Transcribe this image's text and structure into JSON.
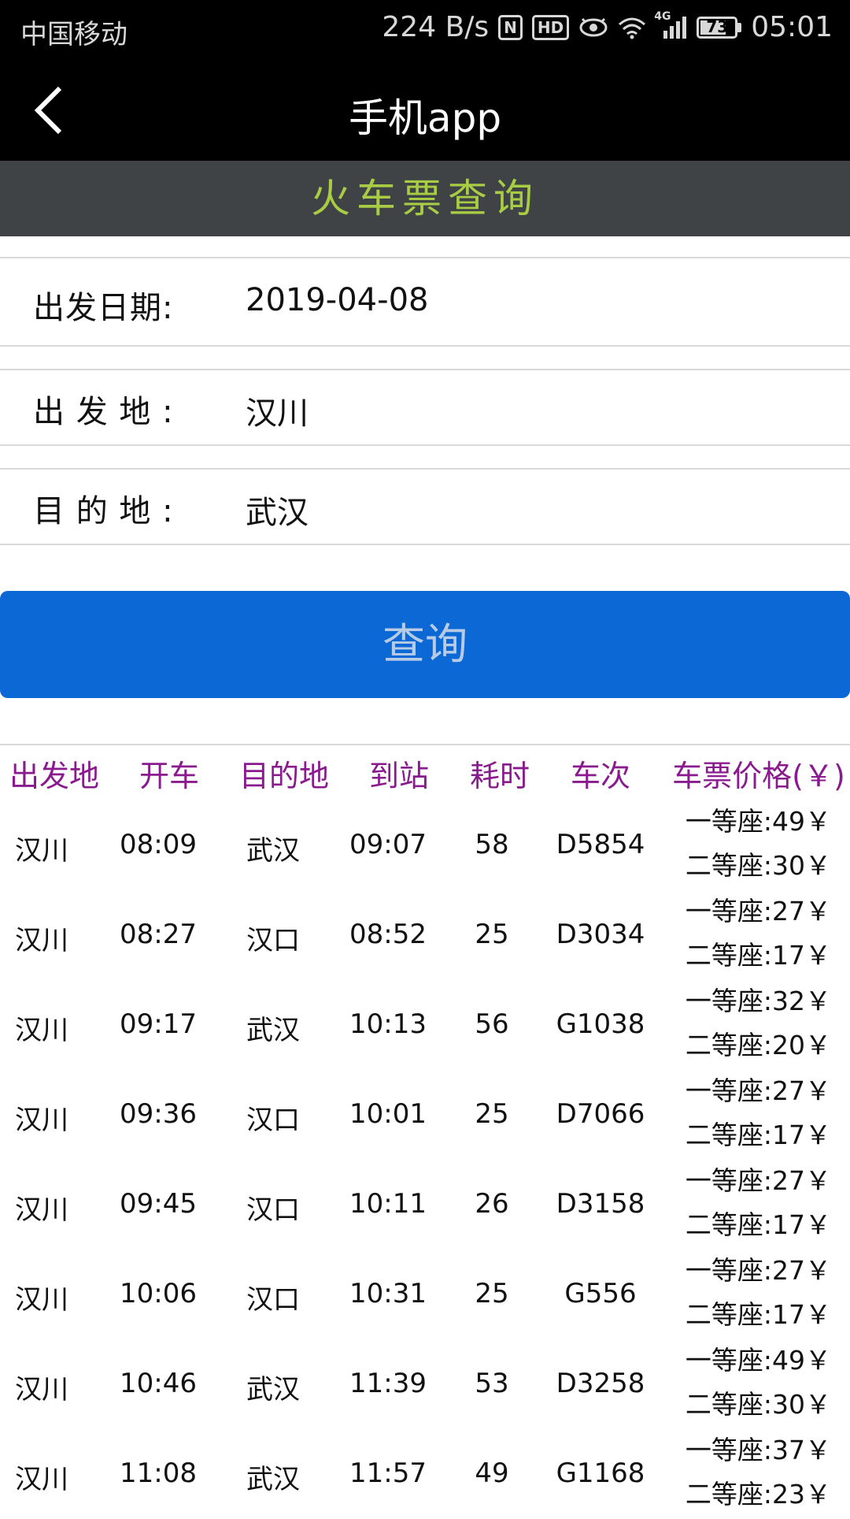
{
  "status_bar": {
    "carrier": "中国移动",
    "net_speed": "224 B/s",
    "nfc": "N",
    "hd": "HD",
    "network": "4G",
    "battery": "73",
    "time": "05:01"
  },
  "app_bar": {
    "title": "手机app"
  },
  "subheader": {
    "title": "火车票查询"
  },
  "form": {
    "date_label": "出发日期:",
    "date_value": "2019-04-08",
    "from_label": "出 发 地 :",
    "from_value": "汉川",
    "to_label": "目 的 地 :",
    "to_value": "武汉"
  },
  "query_button": {
    "label": "查询"
  },
  "table": {
    "headers": [
      "出发地",
      "开车",
      "目的地",
      "到站",
      "耗时",
      "车次",
      "车票价格(￥)"
    ],
    "rows": [
      {
        "from": "汉川",
        "depart": "08:09",
        "to": "武汉",
        "arrive": "09:07",
        "duration": "58",
        "train": "D5854",
        "first": "一等座:49￥",
        "second": "二等座:30￥"
      },
      {
        "from": "汉川",
        "depart": "08:27",
        "to": "汉口",
        "arrive": "08:52",
        "duration": "25",
        "train": "D3034",
        "first": "一等座:27￥",
        "second": "二等座:17￥"
      },
      {
        "from": "汉川",
        "depart": "09:17",
        "to": "武汉",
        "arrive": "10:13",
        "duration": "56",
        "train": "G1038",
        "first": "一等座:32￥",
        "second": "二等座:20￥"
      },
      {
        "from": "汉川",
        "depart": "09:36",
        "to": "汉口",
        "arrive": "10:01",
        "duration": "25",
        "train": "D7066",
        "first": "一等座:27￥",
        "second": "二等座:17￥"
      },
      {
        "from": "汉川",
        "depart": "09:45",
        "to": "汉口",
        "arrive": "10:11",
        "duration": "26",
        "train": "D3158",
        "first": "一等座:27￥",
        "second": "二等座:17￥"
      },
      {
        "from": "汉川",
        "depart": "10:06",
        "to": "汉口",
        "arrive": "10:31",
        "duration": "25",
        "train": "G556",
        "first": "一等座:27￥",
        "second": "二等座:17￥"
      },
      {
        "from": "汉川",
        "depart": "10:46",
        "to": "武汉",
        "arrive": "11:39",
        "duration": "53",
        "train": "D3258",
        "first": "一等座:49￥",
        "second": "二等座:30￥"
      },
      {
        "from": "汉川",
        "depart": "11:08",
        "to": "武汉",
        "arrive": "11:57",
        "duration": "49",
        "train": "G1168",
        "first": "一等座:37￥",
        "second": "二等座:23￥"
      }
    ]
  },
  "colors": {
    "app_bar": "#000000",
    "subheader_bg": "#3f4346",
    "subheader_text": "#a9cc45",
    "query_button": "#0c68d4",
    "table_header": "#8a1b8e"
  },
  "icons": {
    "back": "chevron-left-icon",
    "wifi": "wifi-icon",
    "eye": "eye-comfort-icon",
    "signal": "signal-icon",
    "battery": "battery-icon"
  }
}
